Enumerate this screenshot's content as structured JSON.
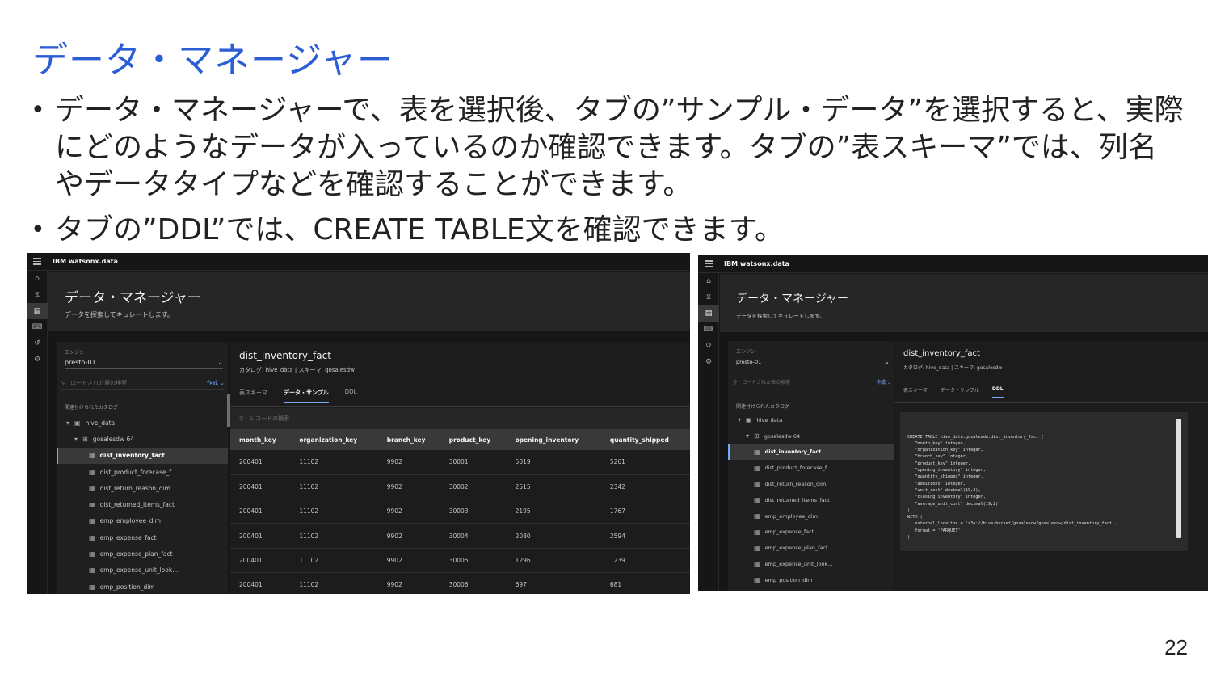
{
  "slide": {
    "title": "データ・マネージャー",
    "bullet1": "データ・マネージャーで、表を選択後、タブの”サンプル・データ”を選択すると、実際にどのようなデータが入っているのか確認できます。タブの”表スキーマ”では、列名やデータタイプなどを確認することができます。",
    "bullet2": "タブの”DDL”では、CREATE TABLE文を確認できます。",
    "page_number": "22"
  },
  "app": {
    "brand": "IBM watsonx.data",
    "header_title": "データ・マネージャー",
    "header_subtitle": "データを探索してキュレートします。",
    "engine_label": "エンジン",
    "engine_value": "presto-01",
    "search_placeholder": "ロードされた表の検索",
    "create_label": "作成 ⌄",
    "catalog_section": "関連付けられたカタログ",
    "tree": [
      {
        "label": "hive_data",
        "indent": 1
      },
      {
        "label": "gosalesdw  64",
        "indent": 2
      },
      {
        "label": "dist_inventory_fact",
        "indent": 3,
        "selected": true
      },
      {
        "label": "dist_product_forecase_f...",
        "indent": 3
      },
      {
        "label": "dist_return_reason_dim",
        "indent": 3
      },
      {
        "label": "dist_returned_items_fact",
        "indent": 3
      },
      {
        "label": "emp_employee_dim",
        "indent": 3
      },
      {
        "label": "emp_expense_fact",
        "indent": 3
      },
      {
        "label": "emp_expense_plan_fact",
        "indent": 3
      },
      {
        "label": "emp_expense_unit_look...",
        "indent": 3
      },
      {
        "label": "emp_position_dim",
        "indent": 3
      }
    ],
    "table_title": "dist_inventory_fact",
    "table_meta": "カタログ: hive_data | スキーマ: gosalesdw",
    "tabs": [
      "表スキーマ",
      "データ・サンプル",
      "DDL"
    ],
    "record_search_placeholder": "レコードの検索",
    "columns": [
      "month_key",
      "organization_key",
      "branch_key",
      "product_key",
      "opening_inventory",
      "quantity_shipped"
    ],
    "rows": [
      [
        "200401",
        "11102",
        "9902",
        "30001",
        "5019",
        "5261"
      ],
      [
        "200401",
        "11102",
        "9902",
        "30002",
        "2515",
        "2342"
      ],
      [
        "200401",
        "11102",
        "9902",
        "30003",
        "2195",
        "1767"
      ],
      [
        "200401",
        "11102",
        "9902",
        "30004",
        "2080",
        "2594"
      ],
      [
        "200401",
        "11102",
        "9902",
        "30005",
        "1296",
        "1239"
      ],
      [
        "200401",
        "11102",
        "9902",
        "30006",
        "697",
        "681"
      ]
    ],
    "ddl_text": "CREATE TABLE hive_data.gosalesdw.dist_inventory_fact (\n   \"month_key\" integer,\n   \"organization_key\" integer,\n   \"branch_key\" integer,\n   \"product_key\" integer,\n   \"opening_inventory\" integer,\n   \"quantity_shipped\" integer,\n   \"additions\" integer,\n   \"unit_cost\" decimal(19,2),\n   \"closing_inventory\" integer,\n   \"average_unit_cost\" decimal(19,2)\n)\nWITH (\n   external_location = 's3a://hive-bucket/gosalesdw/gosalesdw/dist_inventory_fact',\n   format = 'PARQUET'\n)",
    "icons": [
      "home-icon",
      "hourglass-icon",
      "data-manager-icon",
      "query-icon",
      "history-icon",
      "settings-icon"
    ]
  }
}
